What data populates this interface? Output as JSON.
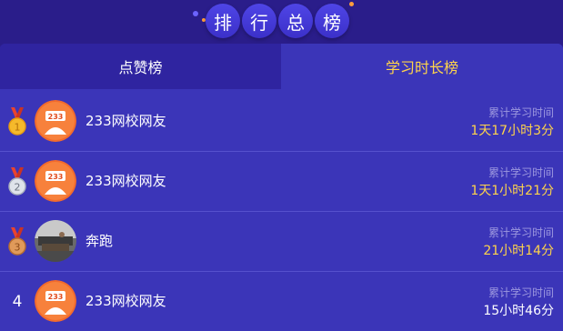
{
  "header": {
    "title_chars": [
      "排",
      "行",
      "总",
      "榜"
    ]
  },
  "tabs": [
    {
      "label": "点赞榜",
      "active": false
    },
    {
      "label": "学习时长榜",
      "active": true
    }
  ],
  "ranking": [
    {
      "rank": "1",
      "medal": "gold",
      "avatar": "233-logo",
      "name": "233网校网友",
      "stat_label": "累计学习时间",
      "stat_value": "1天17小时3分"
    },
    {
      "rank": "2",
      "medal": "silver",
      "avatar": "233-logo",
      "name": "233网校网友",
      "stat_label": "累计学习时间",
      "stat_value": "1天1小时21分"
    },
    {
      "rank": "3",
      "medal": "bronze",
      "avatar": "photo",
      "name": "奔跑",
      "stat_label": "累计学习时间",
      "stat_value": "21小时14分"
    },
    {
      "rank": "4",
      "medal": "none",
      "avatar": "233-logo",
      "name": "233网校网友",
      "stat_label": "累计学习时间",
      "stat_value": "15小时46分"
    }
  ],
  "colors": {
    "background": "#2b1f8f",
    "panel": "#3b35b8",
    "accent_yellow": "#ffd44a",
    "label_muted": "#9c97df"
  },
  "icons": {
    "medal": "medal-icon",
    "avatar_logo": "233-logo-avatar"
  }
}
